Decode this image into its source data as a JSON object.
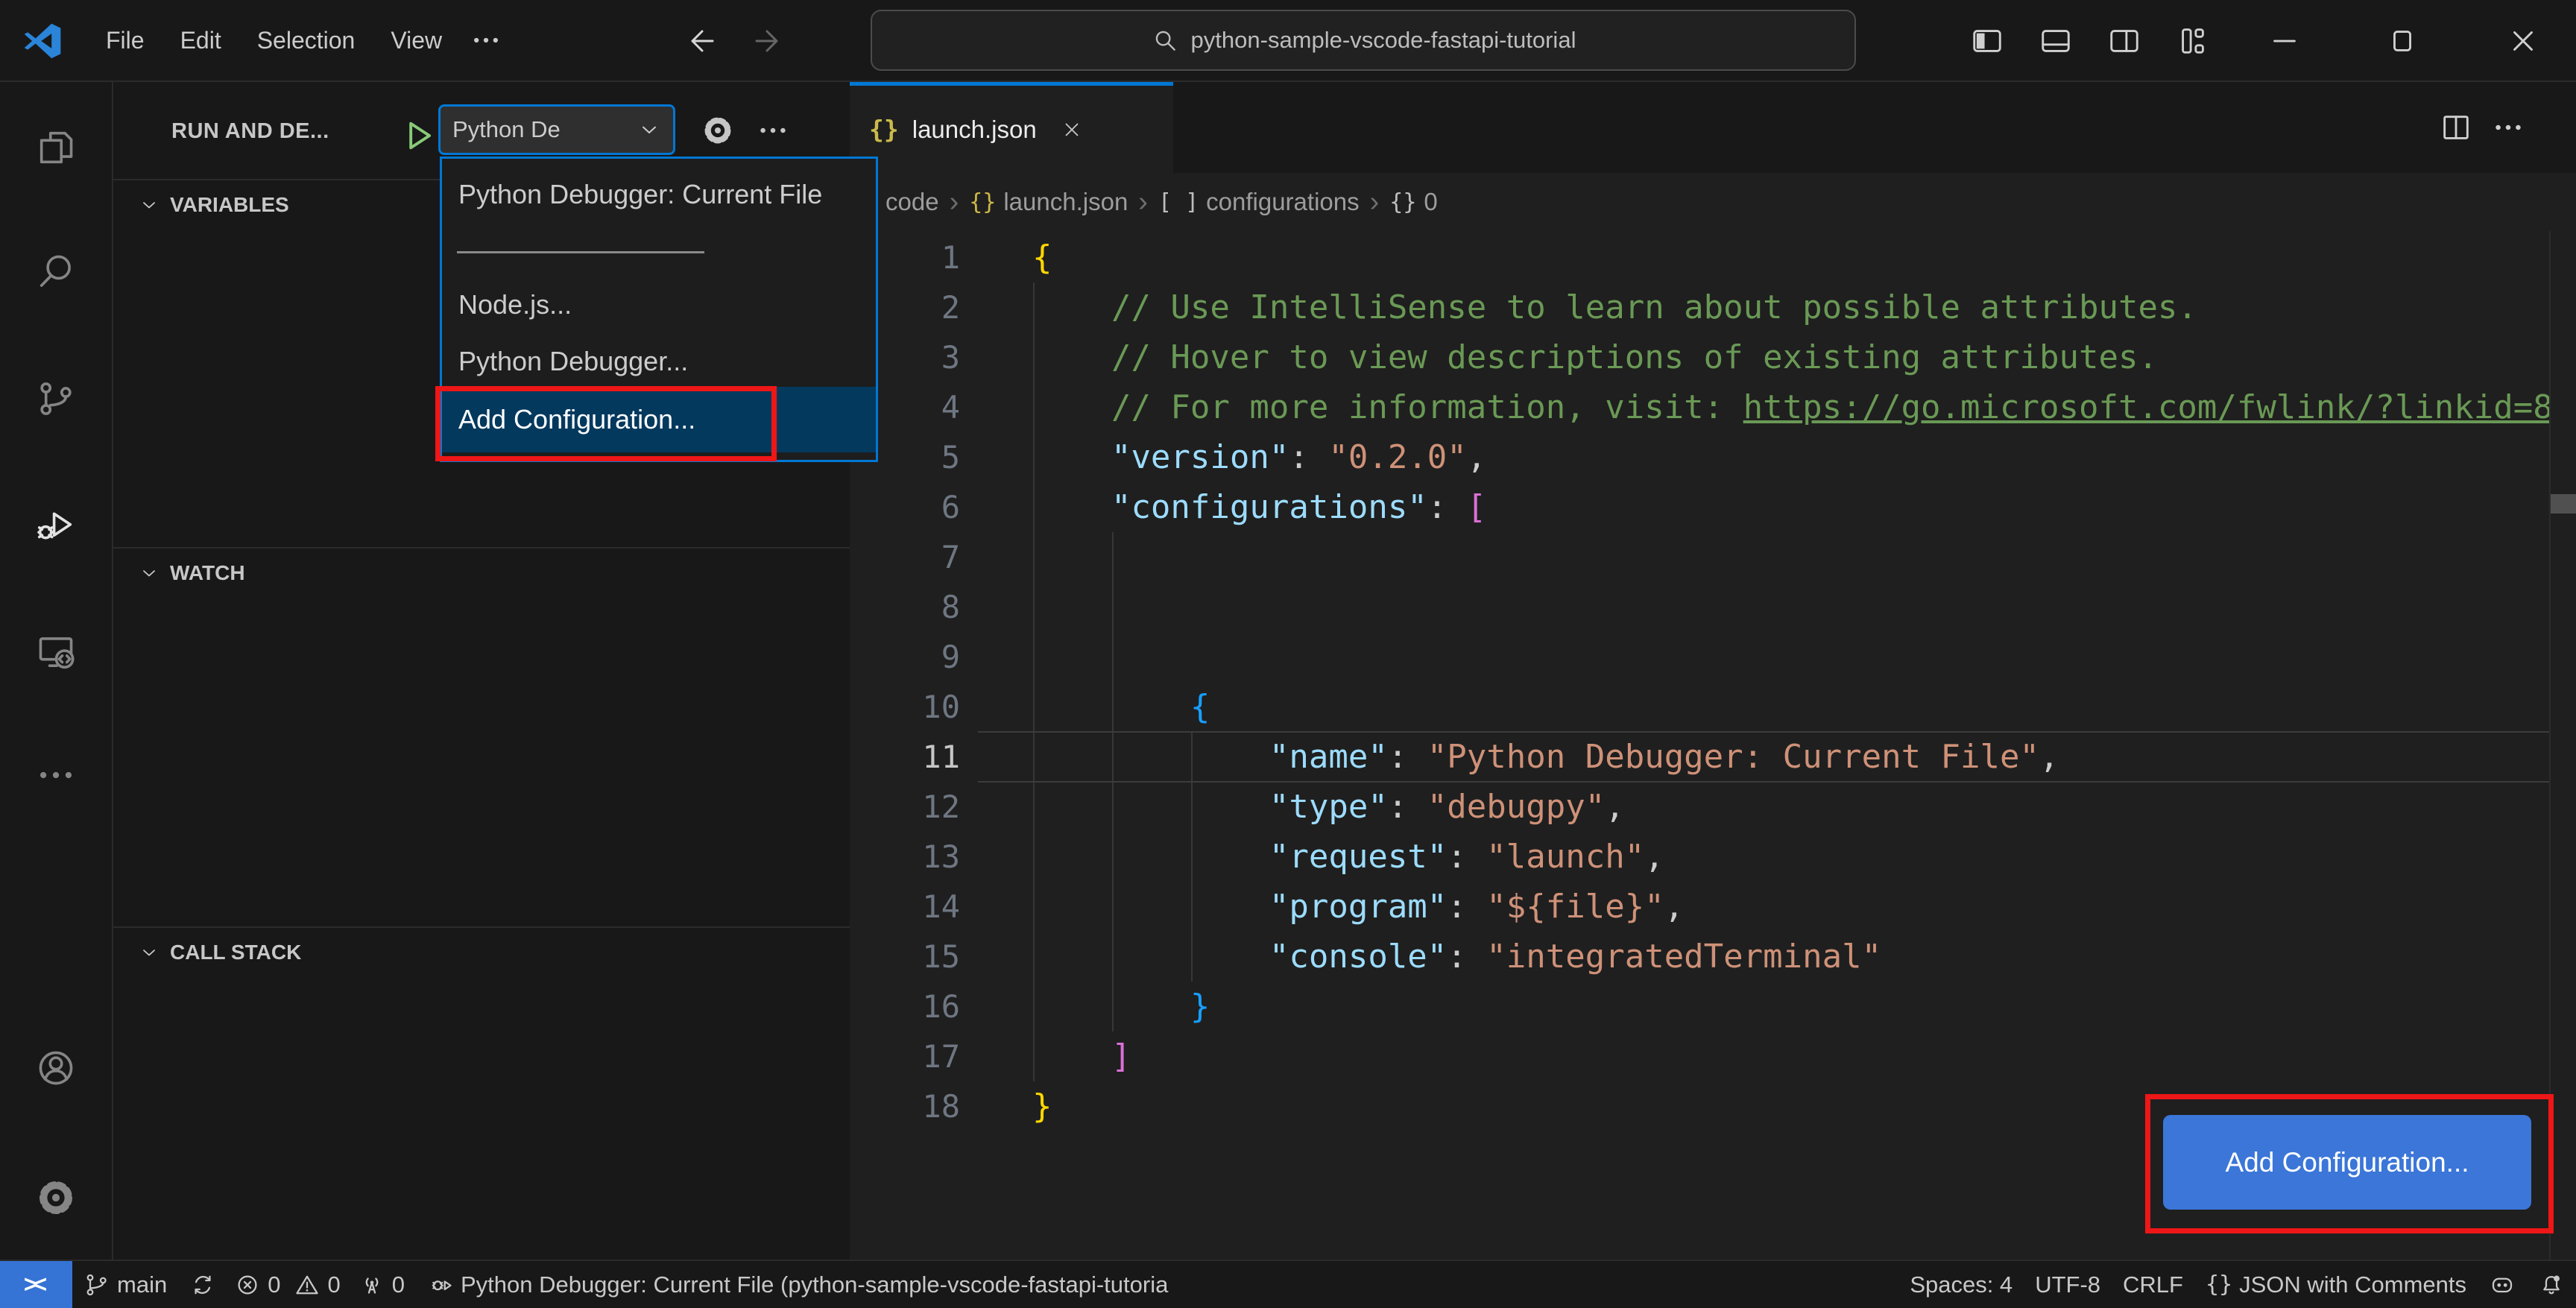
{
  "colors": {
    "accent": "#0078d4",
    "annotation_red": "#ee1616",
    "button_blue": "#3b76d8",
    "selection_blue": "#04395e",
    "debug_green": "#89ca78"
  },
  "title_bar": {
    "menus": [
      "File",
      "Edit",
      "Selection",
      "View"
    ],
    "more_icon": "ellipsis-icon",
    "back_icon": "arrow-left-icon",
    "forward_icon": "arrow-right-icon",
    "search_value": "python-sample-vscode-fastapi-tutorial",
    "search_icon": "search-icon",
    "layout_controls": [
      "layout-sidebar-icon",
      "layout-panel-icon",
      "layout-sidebar-right-icon",
      "layout-customize-icon"
    ],
    "window_controls": [
      "minimize-icon",
      "maximize-icon",
      "close-icon"
    ]
  },
  "activity_bar": {
    "items": [
      {
        "name": "explorer",
        "icon": "files-icon",
        "active": false
      },
      {
        "name": "search",
        "icon": "search-side-icon",
        "active": false
      },
      {
        "name": "source-control",
        "icon": "source-control-icon",
        "active": false
      },
      {
        "name": "run-and-debug",
        "icon": "debug-icon",
        "active": true
      },
      {
        "name": "remote-explorer",
        "icon": "remote-explorer-icon",
        "active": false
      },
      {
        "name": "more",
        "icon": "ellipsis-icon",
        "active": false
      }
    ],
    "bottom_items": [
      {
        "name": "accounts",
        "icon": "account-icon"
      },
      {
        "name": "settings",
        "icon": "gear-icon"
      }
    ]
  },
  "sidebar": {
    "title": "RUN AND DE...",
    "play_icon": "play-icon",
    "config_select_value": "Python De",
    "select_chevron": "chevron-down-icon",
    "gear_icon": "gear-icon",
    "more_icon": "ellipsis-icon",
    "sections": [
      {
        "label": "VARIABLES"
      },
      {
        "label": "WATCH"
      },
      {
        "label": "CALL STACK"
      }
    ],
    "dropdown": {
      "items": [
        {
          "kind": "item",
          "label": "Python Debugger: Current File"
        },
        {
          "kind": "separator"
        },
        {
          "kind": "item",
          "label": "Node.js..."
        },
        {
          "kind": "item",
          "label": "Python Debugger..."
        },
        {
          "kind": "selected",
          "label": "Add Configuration...",
          "annotated": true
        }
      ]
    }
  },
  "editor": {
    "tab": {
      "icon": "{}",
      "label": "launch.json",
      "close_icon": "close-icon"
    },
    "actions": [
      "split-editor-icon",
      "ellipsis-icon"
    ],
    "breadcrumb": [
      {
        "text": "code"
      },
      {
        "icon": "{}",
        "icon_color": "yellow",
        "text": "launch.json"
      },
      {
        "icon": "[ ]",
        "text": "configurations"
      },
      {
        "icon": "{}",
        "text": "0"
      }
    ],
    "lines": [
      {
        "n": 1,
        "indent": 0,
        "seg": [
          [
            "b1",
            "{"
          ]
        ]
      },
      {
        "n": 2,
        "indent": 4,
        "seg": [
          [
            "cmt",
            "// Use IntelliSense to learn about possible attributes."
          ]
        ]
      },
      {
        "n": 3,
        "indent": 4,
        "seg": [
          [
            "cmt",
            "// Hover to view descriptions of existing attributes."
          ]
        ]
      },
      {
        "n": 4,
        "indent": 4,
        "seg": [
          [
            "cmt",
            "// For more information, visit: "
          ],
          [
            "cmt-link",
            "https://go.microsoft.com/fwlink/?linkid=8"
          ]
        ]
      },
      {
        "n": 5,
        "indent": 4,
        "seg": [
          [
            "key",
            "\"version\""
          ],
          [
            "p",
            ": "
          ],
          [
            "str",
            "\"0.2.0\""
          ],
          [
            "p",
            ","
          ]
        ]
      },
      {
        "n": 6,
        "indent": 4,
        "seg": [
          [
            "key",
            "\"configurations\""
          ],
          [
            "p",
            ": "
          ],
          [
            "b2",
            "["
          ]
        ]
      },
      {
        "n": 7,
        "indent": 0,
        "seg": []
      },
      {
        "n": 8,
        "indent": 0,
        "seg": []
      },
      {
        "n": 9,
        "indent": 0,
        "seg": []
      },
      {
        "n": 10,
        "indent": 8,
        "seg": [
          [
            "b3",
            "{"
          ]
        ]
      },
      {
        "n": 11,
        "indent": 12,
        "current": true,
        "seg": [
          [
            "key",
            "\"name\""
          ],
          [
            "p",
            ": "
          ],
          [
            "str",
            "\"Python Debugger: Current File\""
          ],
          [
            "p",
            ","
          ]
        ]
      },
      {
        "n": 12,
        "indent": 12,
        "seg": [
          [
            "key",
            "\"type\""
          ],
          [
            "p",
            ": "
          ],
          [
            "str",
            "\"debugpy\""
          ],
          [
            "p",
            ","
          ]
        ]
      },
      {
        "n": 13,
        "indent": 12,
        "seg": [
          [
            "key",
            "\"request\""
          ],
          [
            "p",
            ": "
          ],
          [
            "str",
            "\"launch\""
          ],
          [
            "p",
            ","
          ]
        ]
      },
      {
        "n": 14,
        "indent": 12,
        "seg": [
          [
            "key",
            "\"program\""
          ],
          [
            "p",
            ": "
          ],
          [
            "str",
            "\"${file}\""
          ],
          [
            "p",
            ","
          ]
        ]
      },
      {
        "n": 15,
        "indent": 12,
        "seg": [
          [
            "key",
            "\"console\""
          ],
          [
            "p",
            ": "
          ],
          [
            "str",
            "\"integratedTerminal\""
          ]
        ]
      },
      {
        "n": 16,
        "indent": 8,
        "seg": [
          [
            "b3",
            "}"
          ]
        ]
      },
      {
        "n": 17,
        "indent": 4,
        "seg": [
          [
            "b2",
            "]"
          ]
        ]
      },
      {
        "n": 18,
        "indent": 0,
        "seg": [
          [
            "b1",
            "}"
          ]
        ]
      }
    ]
  },
  "add_config_button": {
    "label": "Add Configuration...",
    "annotated": true
  },
  "status_bar": {
    "left": [
      {
        "name": "remote-indicator",
        "remote": true,
        "text": "><"
      },
      {
        "name": "git-branch",
        "icon": "git-branch-icon",
        "text": "main"
      },
      {
        "name": "sync",
        "icon": "sync-icon",
        "text": ""
      },
      {
        "name": "errors",
        "icon": "error-icon",
        "text": "0",
        "tight": true
      },
      {
        "name": "warnings",
        "icon": "warning-icon",
        "text": "0",
        "tight": true
      },
      {
        "name": "ports",
        "icon": "ports-icon",
        "text": "0"
      },
      {
        "name": "debug-status",
        "icon": "debug-status-icon",
        "text": "Python Debugger: Current File (python-sample-vscode-fastapi-tutoria"
      }
    ],
    "right": [
      {
        "name": "indentation",
        "text": "Spaces: 4"
      },
      {
        "name": "encoding",
        "text": "UTF-8"
      },
      {
        "name": "eol",
        "text": "CRLF"
      },
      {
        "name": "language-mode",
        "braces": "{}",
        "text": "JSON with Comments"
      },
      {
        "name": "copilot",
        "icon": "copilot-icon",
        "text": ""
      },
      {
        "name": "notifications",
        "icon": "bell-icon",
        "text": ""
      }
    ]
  }
}
